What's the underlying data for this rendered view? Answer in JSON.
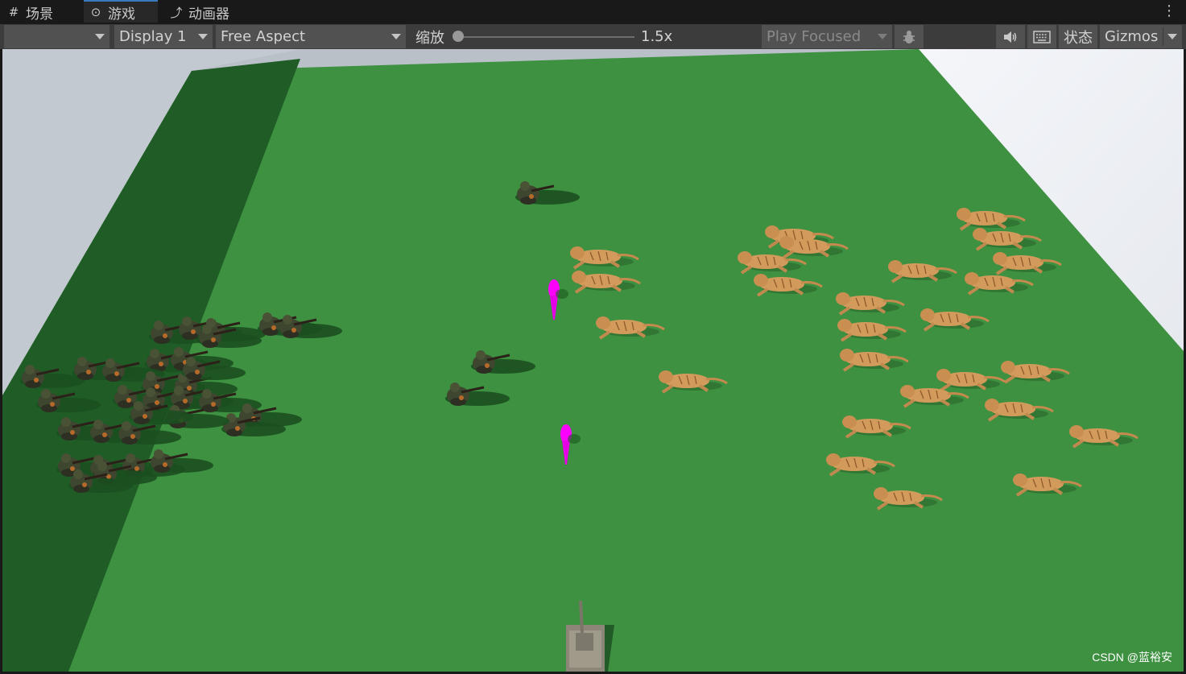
{
  "tabs": [
    {
      "icon": "#",
      "label": "场景"
    },
    {
      "icon": "⊙",
      "label": "游戏"
    },
    {
      "icon": "⤴",
      "label": "动画器"
    }
  ],
  "toolbar": {
    "display": "Display 1",
    "aspect": "Free Aspect",
    "scale_label": "缩放",
    "scale_value": "1.5x",
    "play_mode": "Play Focused",
    "stats": "状态",
    "gizmos": "Gizmos"
  },
  "scene": {
    "unit_counts": {
      "soldiers": 35,
      "tigers": 26,
      "markers": 2,
      "tank": 1
    },
    "colors": {
      "ground": "#3d9140",
      "shadow_ground": "#1e5a25",
      "marker": "#ff00ff",
      "tiger": "#d09a5a"
    }
  },
  "watermark": "CSDN @蓝裕安"
}
